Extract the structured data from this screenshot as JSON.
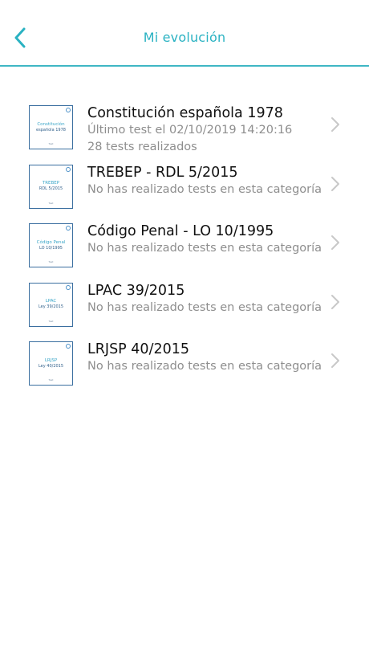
{
  "header": {
    "title": "Mi evolución",
    "back_icon": "chevron-left-icon",
    "accent": "#2ab2c2"
  },
  "items": [
    {
      "cover_line1": "Constitución",
      "cover_line2": "española 1978",
      "cover_footer": "Test",
      "title": "Constitución española 1978",
      "sub1": "Último test el 02/10/2019 14:20:16",
      "sub2": "28 tests realizados"
    },
    {
      "cover_line1": "TREBEP",
      "cover_line2": "RDL 5/2015",
      "cover_footer": "Test",
      "title": "TREBEP - RDL 5/2015",
      "sub1": "No has realizado tests en esta categoría"
    },
    {
      "cover_line1": "Código Penal",
      "cover_line2": "LO 10/1995",
      "cover_footer": "Test",
      "title": "Código Penal - LO 10/1995",
      "sub1": "No has realizado tests en esta categoría"
    },
    {
      "cover_line1": "LPAC",
      "cover_line2": "Ley 39/2015",
      "cover_footer": "Test",
      "title": "LPAC 39/2015",
      "sub1": "No has realizado tests en esta categoría"
    },
    {
      "cover_line1": "LRJSP",
      "cover_line2": "Ley 40/2015",
      "cover_footer": "Test",
      "title": "LRJSP 40/2015",
      "sub1": "No has realizado tests en esta categoría"
    }
  ]
}
